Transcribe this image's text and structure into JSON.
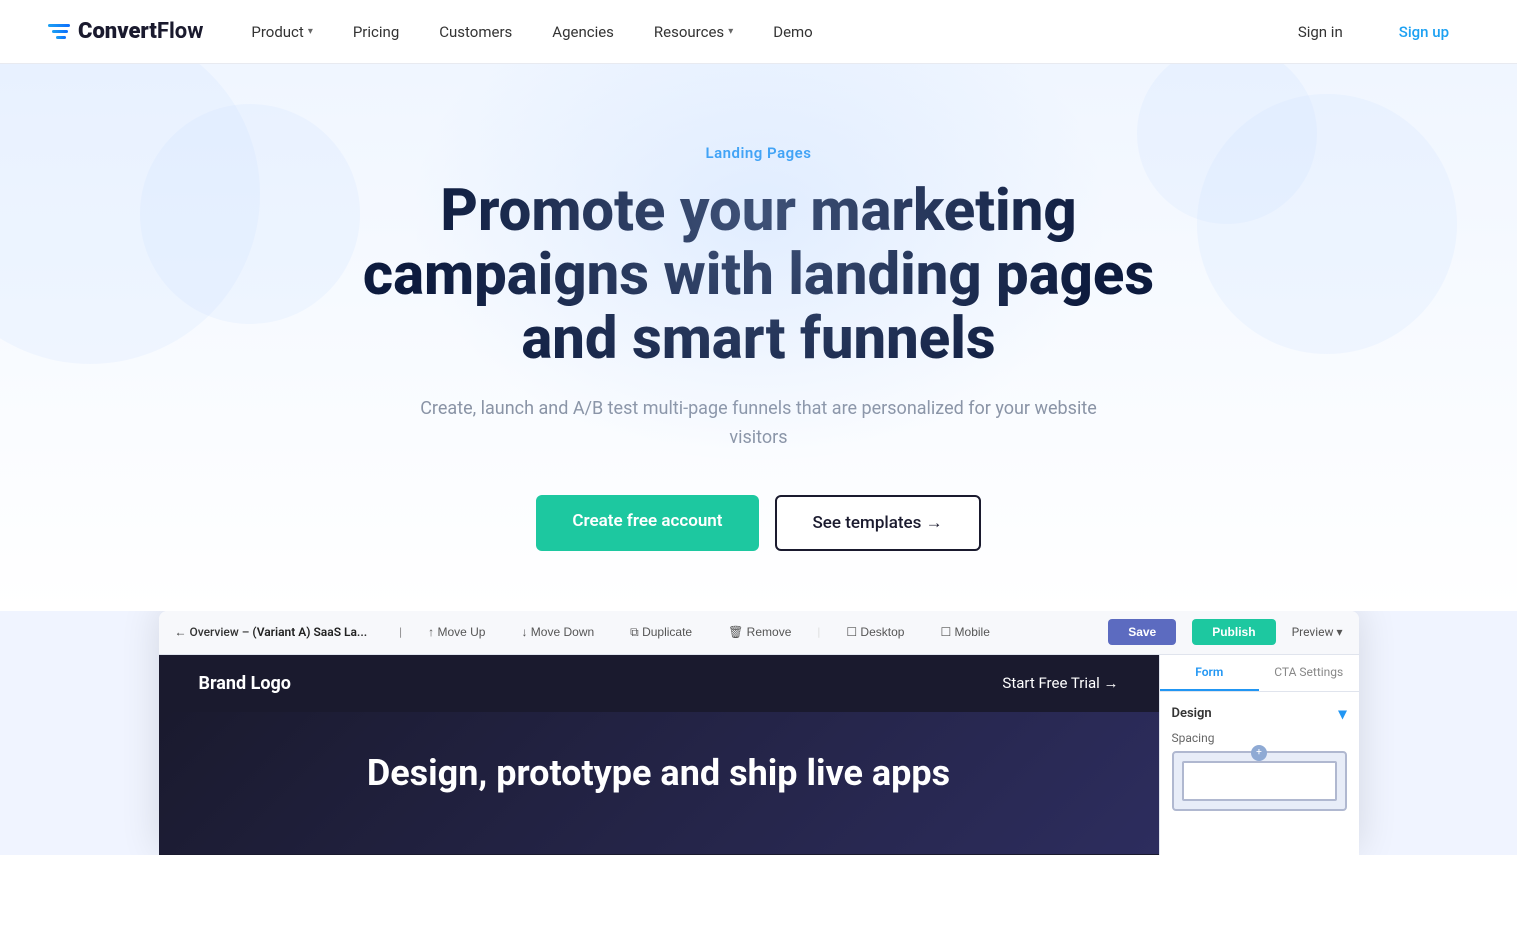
{
  "brand": {
    "name_bold": "Convert",
    "name_regular": "Flow",
    "logo_alt": "ConvertFlow logo"
  },
  "nav": {
    "links": [
      {
        "id": "product",
        "label": "Product",
        "has_dropdown": true
      },
      {
        "id": "pricing",
        "label": "Pricing",
        "has_dropdown": false
      },
      {
        "id": "customers",
        "label": "Customers",
        "has_dropdown": false
      },
      {
        "id": "agencies",
        "label": "Agencies",
        "has_dropdown": false
      },
      {
        "id": "resources",
        "label": "Resources",
        "has_dropdown": true
      },
      {
        "id": "demo",
        "label": "Demo",
        "has_dropdown": false
      }
    ],
    "signin_label": "Sign in",
    "signup_label": "Sign up"
  },
  "hero": {
    "tag": "Landing Pages",
    "title": "Promote your marketing campaigns with landing pages and smart funnels",
    "subtitle": "Create, launch and A/B test multi-page funnels that are personalized for your website visitors",
    "cta_primary": "Create free account",
    "cta_secondary": "See templates →"
  },
  "app_preview": {
    "toolbar": {
      "breadcrumb_prefix": "← Overview –",
      "breadcrumb_active": "(Variant A) SaaS La...",
      "actions": [
        {
          "id": "move-up",
          "label": "↑ Move Up"
        },
        {
          "id": "move-down",
          "label": "↓ Move Down"
        },
        {
          "id": "duplicate",
          "label": "⧉ Duplicate"
        },
        {
          "id": "remove",
          "label": "🗑 Remove"
        },
        {
          "id": "desktop",
          "label": "⬜ Desktop"
        },
        {
          "id": "mobile",
          "label": "⬜ Mobile"
        }
      ],
      "save_label": "Save",
      "publish_label": "Publish",
      "preview_label": "Preview ▾"
    },
    "canvas": {
      "brand": "Brand Logo",
      "cta_link": "Start Free Trial →",
      "headline": "Design, prototype and ship live apps"
    },
    "panel": {
      "tab_form": "Form",
      "tab_cta": "CTA Settings",
      "section_label": "Design",
      "spacing_label": "Spacing"
    }
  },
  "colors": {
    "primary_teal": "#1dc8a0",
    "primary_blue": "#2196f3",
    "dark_navy": "#0d1b3e",
    "text_gray": "#8a94a6"
  }
}
